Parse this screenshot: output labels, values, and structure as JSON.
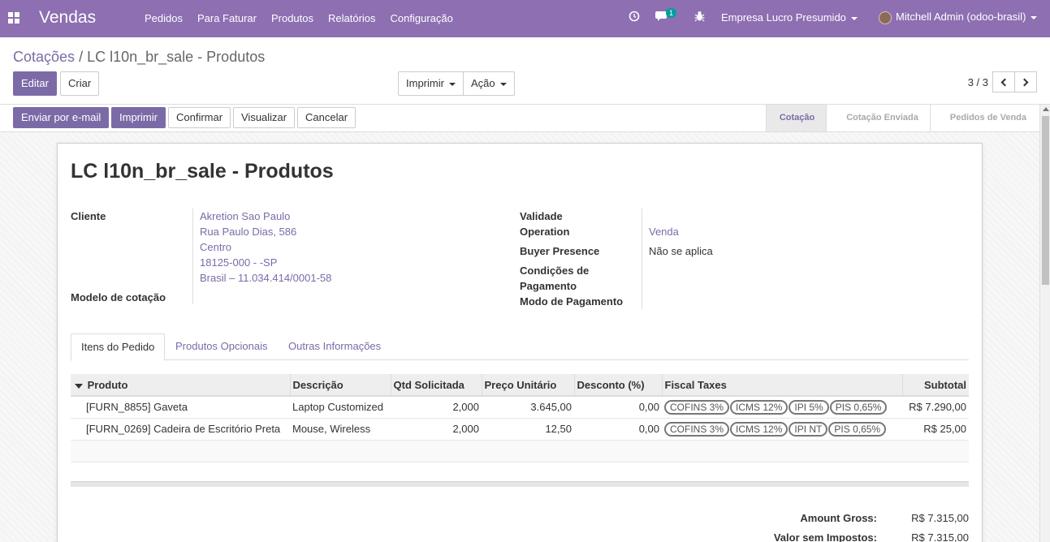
{
  "navbar": {
    "brand": "Vendas",
    "menu": [
      "Pedidos",
      "Para Faturar",
      "Produtos",
      "Relatórios",
      "Configuração"
    ],
    "message_count": "1",
    "company": "Empresa Lucro Presumido",
    "user": "Mitchell Admin (odoo-brasil)"
  },
  "control": {
    "breadcrumb_parent": "Cotações",
    "breadcrumb_sep": "/",
    "breadcrumb_current": "LC l10n_br_sale - Produtos",
    "edit_label": "Editar",
    "create_label": "Criar",
    "print_label": "Imprimir",
    "action_label": "Ação",
    "pager_value": "3 / 3"
  },
  "statusbar": {
    "buttons": [
      "Enviar por e-mail",
      "Imprimir",
      "Confirmar",
      "Visualizar",
      "Cancelar"
    ],
    "stages": [
      "Cotação",
      "Cotação Enviada",
      "Pedidos de Venda"
    ],
    "active_stage": "Cotação"
  },
  "form": {
    "title": "LC l10n_br_sale - Produtos",
    "customer_label": "Cliente",
    "customer_lines": [
      "Akretion Sao Paulo",
      "Rua Paulo Dias, 586",
      "Centro",
      "18125-000 - -SP",
      "Brasil – 11.034.414/0001-58"
    ],
    "template_label": "Modelo de cotação",
    "validity_label": "Validade",
    "operation_label": "Operation",
    "operation_value": "Venda",
    "buyer_presence_label": "Buyer Presence",
    "buyer_presence_value": "Não se aplica",
    "payment_terms_label_1": "Condições de",
    "payment_terms_label_2": "Pagamento",
    "payment_mode_label": "Modo de Pagamento"
  },
  "tabs": [
    "Itens do Pedido",
    "Produtos Opcionais",
    "Outras Informações"
  ],
  "table": {
    "headers": [
      "Produto",
      "Descrição",
      "Qtd Solicitada",
      "Preço Unitário",
      "Desconto (%)",
      "Fiscal Taxes",
      "Subtotal"
    ],
    "rows": [
      {
        "product": "[FURN_8855] Gaveta",
        "description": "Laptop Customized",
        "qty": "2,000",
        "price": "3.645,00",
        "discount": "0,00",
        "taxes": [
          "COFINS 3%",
          "ICMS 12%",
          "IPI 5%",
          "PIS 0,65%"
        ],
        "subtotal": "R$ 7.290,00"
      },
      {
        "product": "[FURN_0269] Cadeira de Escritório Preta",
        "description": "Mouse, Wireless",
        "qty": "2,000",
        "price": "12,50",
        "discount": "0,00",
        "taxes": [
          "COFINS 3%",
          "ICMS 12%",
          "IPI NT",
          "PIS 0,65%"
        ],
        "subtotal": "R$ 25,00"
      }
    ]
  },
  "totals": {
    "gross_label": "Amount Gross:",
    "gross_value": "R$ 7.315,00",
    "untaxed_label": "Valor sem Impostos:",
    "untaxed_value": "R$ 7.315,00"
  }
}
